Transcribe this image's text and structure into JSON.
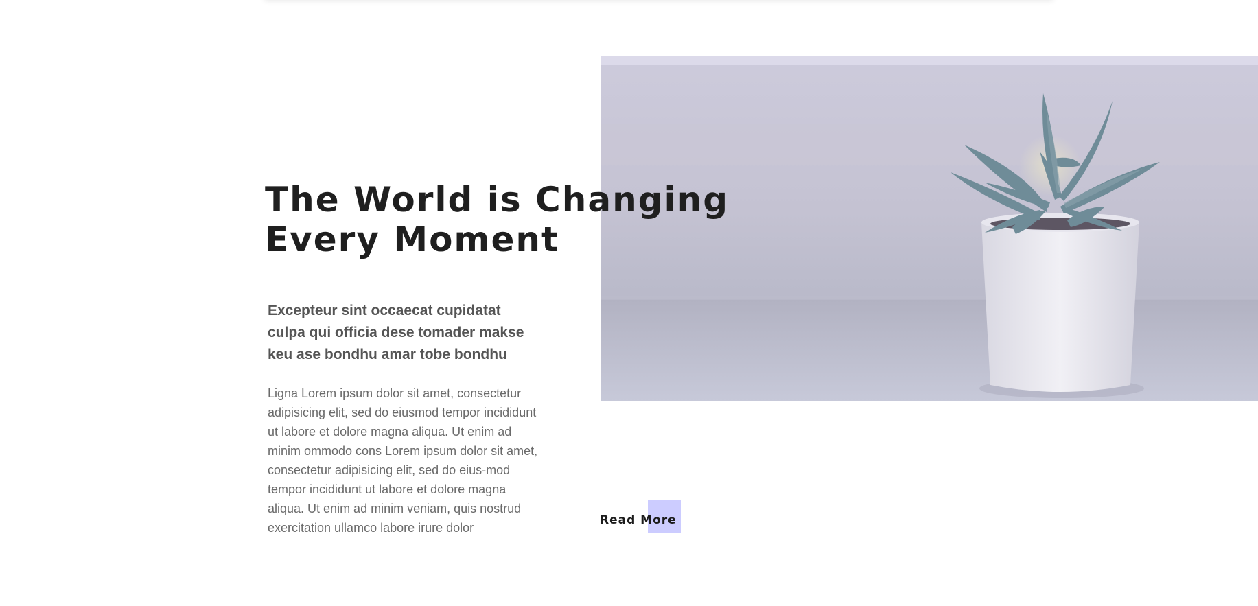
{
  "section": {
    "headline_line1": "The World is Changing",
    "headline_line2": "Every Moment",
    "lead": "Excepteur sint occaecat cupidatat  culpa qui officia dese tomader makse keu ase bondhu amar tobe bondhu",
    "body": "Ligna Lorem ipsum dolor sit amet, consectetur adipisicing elit, sed do eiusmod tempor incididunt ut labore et dolore magna aliqua. Ut enim ad minim ommodo cons Lorem ipsum dolor sit amet, consectetur adipisicing elit, sed do eius-mod tempor incididunt ut labore et dolore magna aliqua. Ut enim ad minim veniam, quis nostrud exercitation ullamco labore irure dolor",
    "read_more_label": "Read More"
  },
  "colors": {
    "accent": "#ccccff",
    "heading": "#1f1f1f",
    "lead_text": "#555555",
    "body_text": "#6a6a6a"
  },
  "image": {
    "subject": "succulent-in-white-pot"
  }
}
